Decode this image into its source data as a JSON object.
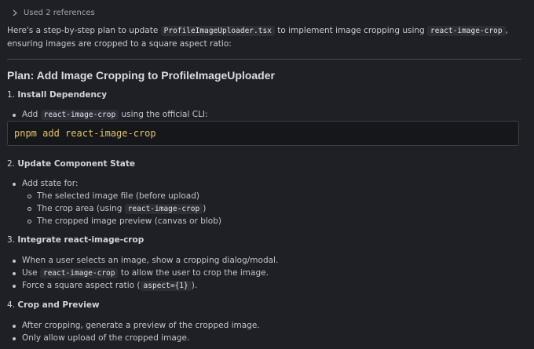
{
  "references": {
    "label": "Used 2 references"
  },
  "intro": {
    "part1": "Here's a step-by-step plan to update ",
    "file": "ProfileImageUploader.tsx",
    "part2": " to implement image cropping using ",
    "lib": "react-image-crop",
    "part3": ", ensuring images are cropped to a square aspect ratio:"
  },
  "plan": {
    "title": "Plan: Add Image Cropping to ProfileImageUploader",
    "steps": [
      {
        "number": "1.",
        "title": "Install Dependency",
        "bullet1_pre": "Add ",
        "bullet1_code": "react-image-crop",
        "bullet1_post": " using the official CLI:",
        "code_cmd": "pnpm",
        "code_arg": "add react-image-crop"
      },
      {
        "number": "2.",
        "title": "Update Component State",
        "bullet1": "Add state for:",
        "sub1": "The selected image file (before upload)",
        "sub2_pre": "The crop area (using ",
        "sub2_code": "react-image-crop",
        "sub2_post": ")",
        "sub3": "The cropped image preview (canvas or blob)"
      },
      {
        "number": "3.",
        "title": "Integrate react-image-crop",
        "bullet1": "When a user selects an image, show a cropping dialog/modal.",
        "bullet2_pre": "Use ",
        "bullet2_code": "react-image-crop",
        "bullet2_post": " to allow the user to crop the image.",
        "bullet3_pre": "Force a square aspect ratio (",
        "bullet3_code": "aspect={1}",
        "bullet3_post": ")."
      },
      {
        "number": "4.",
        "title": "Crop and Preview",
        "bullet1": "After cropping, generate a preview of the cropped image.",
        "bullet2": "Only allow upload of the cropped image."
      }
    ]
  }
}
